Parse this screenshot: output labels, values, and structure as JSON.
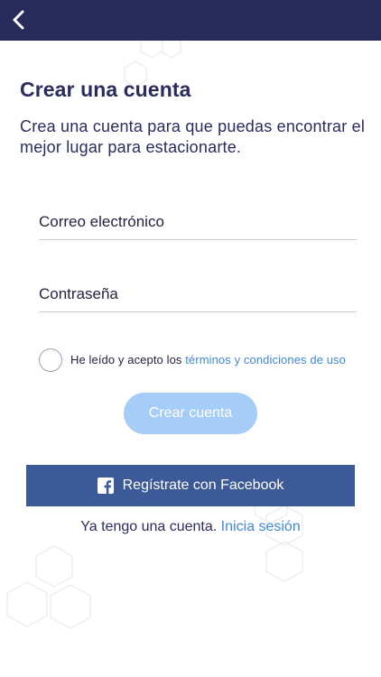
{
  "header": {
    "back_icon": "chevron-left-icon",
    "background_color": "#282a5c"
  },
  "main": {
    "title": "Crear una cuenta",
    "subtitle": "Crea una cuenta para que puedas encontrar el mejor lugar para estacionarte."
  },
  "form": {
    "email_placeholder": "Correo electrónico",
    "password_placeholder": "Contraseña",
    "terms_prefix": "He leído y acepto los ",
    "terms_link": "términos y condiciones de uso",
    "terms_checked": false,
    "create_button_label": "Crear cuenta",
    "create_button_color": "#a5cdf7"
  },
  "facebook": {
    "label": "Regístrate con Facebook",
    "icon": "facebook-icon",
    "color": "#3b5a97"
  },
  "login": {
    "prompt": "Ya tengo una cuenta.",
    "link": "Inicia sesión",
    "link_color": "#4187d9"
  }
}
